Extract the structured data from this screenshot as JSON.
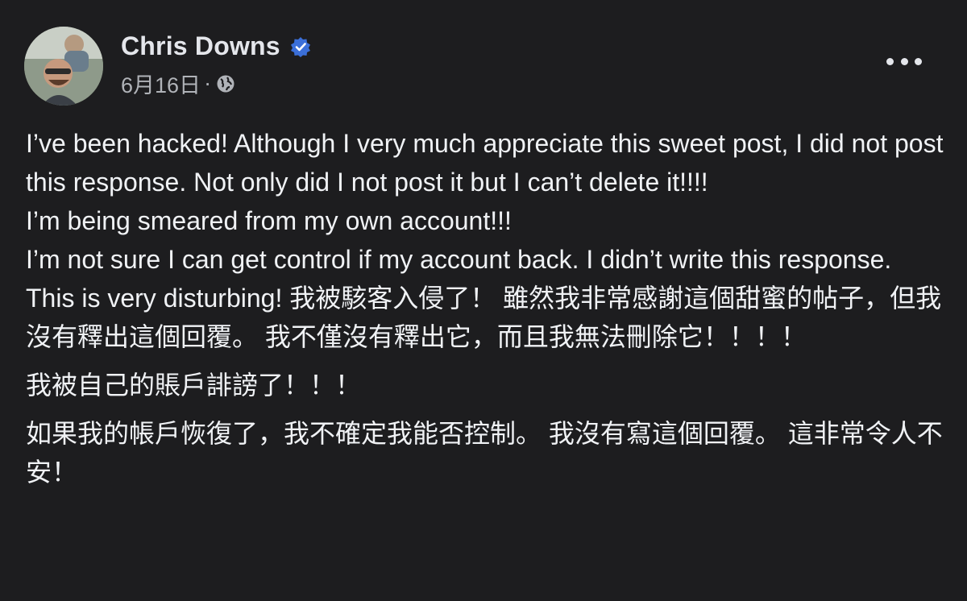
{
  "post": {
    "author": "Chris Downs",
    "date": "6月16日",
    "separator": "·",
    "icons": {
      "verified": "verified-badge-icon",
      "audience": "globe-icon",
      "more": "more-options-icon"
    },
    "colors": {
      "background": "#1d1d1f",
      "text": "#f0f2f5",
      "secondary_text": "#b0b3b8",
      "verified_badge": "#3b6fd8"
    },
    "paragraphs": [
      "I’ve been hacked! Although I very much appreciate this sweet post, I did not post this response. Not only did I not post it but I can’t delete it!!!!",
      "I’m being smeared from my own account!!!",
      "I’m not sure I can get control if my account back. I didn’t write this response. This is very disturbing! 我被駭客入侵了！ 雖然我非常感謝這個甜蜜的帖子，但我沒有釋出這個回覆。 我不僅沒有釋出它，而且我無法刪除它！！！！",
      "我被自己的賬戶誹謗了！！！",
      "如果我的帳戶恢復了，我不確定我能否控制。 我沒有寫這個回覆。 這非常令人不安！"
    ]
  }
}
